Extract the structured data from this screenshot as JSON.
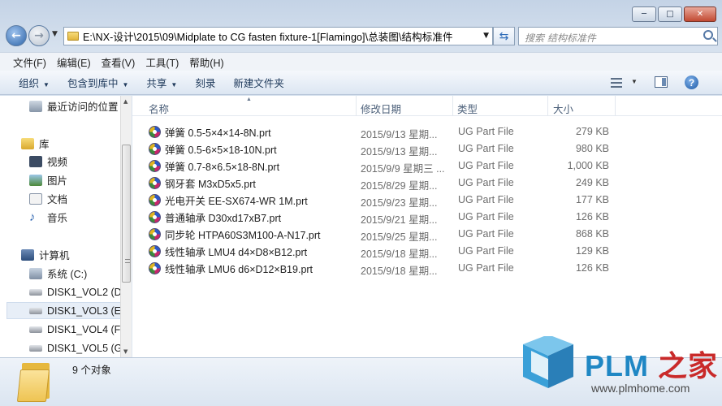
{
  "window": {
    "caption_buttons": {
      "minimize": "─",
      "maximize": "□",
      "close": "✕"
    }
  },
  "nav": {
    "address": "E:\\NX-设计\\2015\\09\\Midplate to CG fasten fixture-1[Flamingo]\\总装图\\结构标准件",
    "search_placeholder": "搜索 结构标准件"
  },
  "menu": [
    "文件(F)",
    "编辑(E)",
    "查看(V)",
    "工具(T)",
    "帮助(H)"
  ],
  "commands": [
    {
      "label": "组织",
      "dropdown": true
    },
    {
      "label": "包含到库中",
      "dropdown": true
    },
    {
      "label": "共享",
      "dropdown": true
    },
    {
      "label": "刻录",
      "dropdown": false
    },
    {
      "label": "新建文件夹",
      "dropdown": false
    }
  ],
  "sidebar": {
    "recent": "最近访问的位置",
    "library": "库",
    "libs": [
      "视频",
      "图片",
      "文档",
      "音乐"
    ],
    "computer": "计算机",
    "drives": [
      "系统 (C:)",
      "DISK1_VOL2 (D",
      "DISK1_VOL3 (E:",
      "DISK1_VOL4 (F:",
      "DISK1_VOL5 (G"
    ]
  },
  "columns": [
    "名称",
    "修改日期",
    "类型",
    "大小"
  ],
  "files": [
    {
      "name": "弹簧 0.5-5×4×14-8N.prt",
      "date": "2015/9/13 星期...",
      "type": "UG Part File",
      "size": "279 KB"
    },
    {
      "name": "弹簧 0.5-6×5×18-10N.prt",
      "date": "2015/9/13 星期...",
      "type": "UG Part File",
      "size": "980 KB"
    },
    {
      "name": "弹簧 0.7-8×6.5×18-8N.prt",
      "date": "2015/9/9 星期三 ...",
      "type": "UG Part File",
      "size": "1,000 KB"
    },
    {
      "name": "钢牙套 M3xD5x5.prt",
      "date": "2015/8/29 星期...",
      "type": "UG Part File",
      "size": "249 KB"
    },
    {
      "name": "光电开关 EE-SX674-WR 1M.prt",
      "date": "2015/9/23 星期...",
      "type": "UG Part File",
      "size": "177 KB"
    },
    {
      "name": "普通轴承 D30xd17xB7.prt",
      "date": "2015/9/21 星期...",
      "type": "UG Part File",
      "size": "126 KB"
    },
    {
      "name": "同步轮 HTPA60S3M100-A-N17.prt",
      "date": "2015/9/25 星期...",
      "type": "UG Part File",
      "size": "868 KB"
    },
    {
      "name": "线性轴承 LMU4 d4×D8×B12.prt",
      "date": "2015/9/18 星期...",
      "type": "UG Part File",
      "size": "129 KB"
    },
    {
      "name": "线性轴承 LMU6 d6×D12×B19.prt",
      "date": "2015/9/18 星期...",
      "type": "UG Part File",
      "size": "126 KB"
    }
  ],
  "details": {
    "count": "9 个对象"
  },
  "watermark": {
    "brand_a": "PLM",
    "brand_b": "之家",
    "url": "www.plmhome.com"
  }
}
